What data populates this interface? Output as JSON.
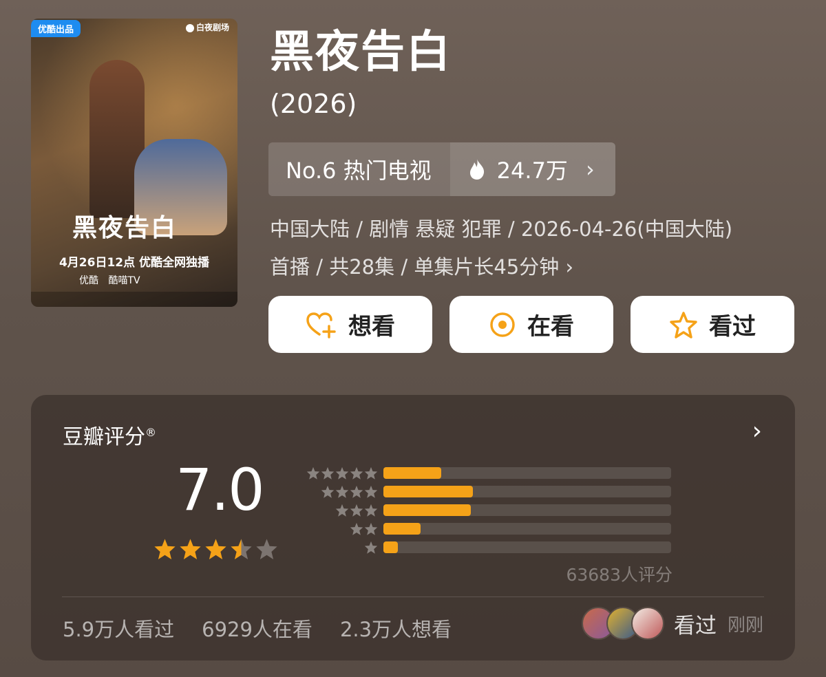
{
  "poster": {
    "badge": "优酷出品",
    "brand": "白夜剧场",
    "title": "黑夜告白",
    "release_line": "4月26日12点 优酷全网独播",
    "platforms": [
      "优酷",
      "酷喵TV"
    ]
  },
  "header": {
    "title": "黑夜告白",
    "year": "(2026)"
  },
  "rank": {
    "label": "No.6 热门电视",
    "heat": "24.7万"
  },
  "meta": {
    "line1": "中国大陆 / 剧情 悬疑 犯罪 / 2026-04-26(中国大陆)",
    "line2": "首播 / 共28集 / 单集片长45分钟"
  },
  "actions": {
    "want": "想看",
    "watching": "在看",
    "watched": "看过"
  },
  "rating": {
    "title": "豆瓣评分",
    "reg": "®",
    "score": "7.0",
    "stars_value": 3.5,
    "stars_max": 5,
    "distribution": [
      {
        "stars": 5,
        "fraction": 0.2
      },
      {
        "stars": 4,
        "fraction": 0.31
      },
      {
        "stars": 3,
        "fraction": 0.305
      },
      {
        "stars": 2,
        "fraction": 0.13
      },
      {
        "stars": 1,
        "fraction": 0.05
      }
    ],
    "raters": "63683人评分"
  },
  "stats": {
    "watched": "5.9万人看过",
    "watching": "6929人在看",
    "want": "2.3万人想看"
  },
  "activity": {
    "label": "看过",
    "time": "刚刚"
  },
  "colors": {
    "accent": "#f5a218",
    "badge_blue": "#1e8cf0"
  }
}
